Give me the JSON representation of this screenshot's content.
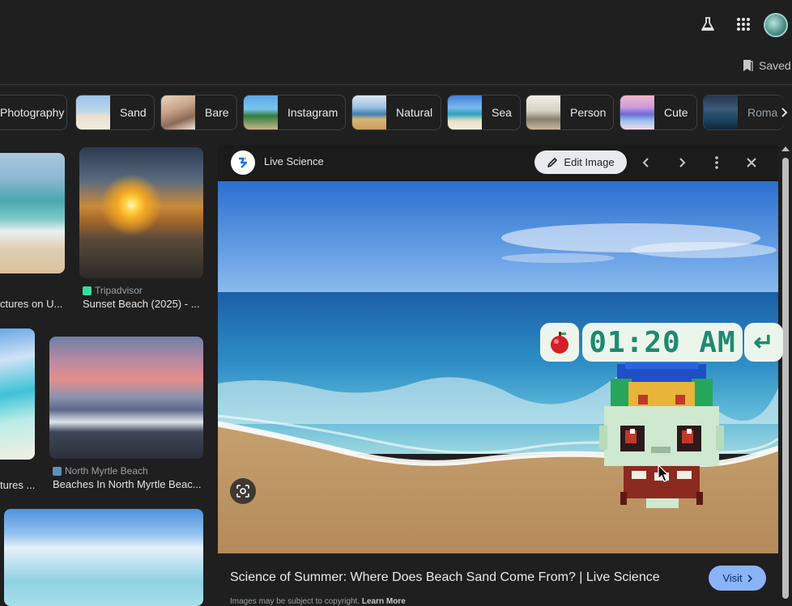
{
  "topbar": {
    "labs_icon": "flask-icon",
    "apps_icon": "apps-grid-icon",
    "avatar_icon": "account-avatar",
    "saved_label": "Saved"
  },
  "chips": [
    {
      "label": "Photography"
    },
    {
      "label": "Sand"
    },
    {
      "label": "Bare"
    },
    {
      "label": "Instagram"
    },
    {
      "label": "Natural"
    },
    {
      "label": "Sea"
    },
    {
      "label": "Person"
    },
    {
      "label": "Cute"
    },
    {
      "label": "Roma"
    }
  ],
  "results": [
    {
      "source": "",
      "caption": "ctures on U..."
    },
    {
      "source": "Tripadvisor",
      "caption": "Sunset Beach (2025) - ..."
    },
    {
      "source": "",
      "caption": "tures ..."
    },
    {
      "source": "North Myrtle Beach",
      "caption": "Beaches In North Myrtle Beac..."
    }
  ],
  "preview": {
    "source_name": "Live Science",
    "edit_label": "Edit Image",
    "title": "Science of Summer: Where Does Beach Sand Come From? | Live Science",
    "visit_label": "Visit",
    "copyright": "Images may be subject to copyright.",
    "learn_more": "Learn More"
  },
  "overlay": {
    "time": "01:20 AM",
    "enter_symbol": "↵"
  }
}
